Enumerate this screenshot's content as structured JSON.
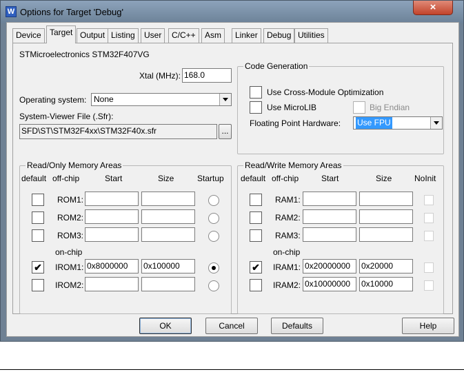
{
  "window": {
    "title": "Options for Target 'Debug'",
    "app_icon_glyph": "W",
    "close_glyph": "×",
    "accent": "#6f8194"
  },
  "tabs": [
    {
      "label": "Device"
    },
    {
      "label": "Target",
      "active": true
    },
    {
      "label": "Output"
    },
    {
      "label": "Listing"
    },
    {
      "label": "User"
    },
    {
      "label": "C/C++"
    },
    {
      "label": "Asm"
    },
    {
      "label": "Linker"
    },
    {
      "label": "Debug"
    },
    {
      "label": "Utilities"
    }
  ],
  "target": {
    "device_name": "STMicroelectronics STM32F407VG",
    "xtal_label": "Xtal (MHz):",
    "xtal_value": "168.0",
    "os_label": "Operating system:",
    "os_value": "None",
    "sfr_label": "System-Viewer File (.Sfr):",
    "sfr_value": "SFD\\ST\\STM32F4xx\\STM32F40x.sfr",
    "browse_label": "..."
  },
  "code_gen": {
    "title": "Code Generation",
    "cross_module": {
      "label": "Use Cross-Module Optimization",
      "checked": false
    },
    "microlib": {
      "label": "Use MicroLIB",
      "checked": false
    },
    "big_endian": {
      "label": "Big Endian",
      "checked": false,
      "disabled": true
    },
    "fpu_label": "Floating Point Hardware:",
    "fpu_value": "Use FPU"
  },
  "ro_memory": {
    "title": "Read/Only Memory Areas",
    "headers": {
      "default": "default",
      "offchip": "off-chip",
      "start": "Start",
      "size": "Size",
      "startup": "Startup"
    },
    "onchip_label": "on-chip",
    "rows": [
      {
        "name": "ROM1:",
        "default": false,
        "start": "",
        "size": "",
        "startup": false
      },
      {
        "name": "ROM2:",
        "default": false,
        "start": "",
        "size": "",
        "startup": false
      },
      {
        "name": "ROM3:",
        "default": false,
        "start": "",
        "size": "",
        "startup": false
      },
      {
        "name": "IROM1:",
        "default": true,
        "start": "0x8000000",
        "size": "0x100000",
        "startup": true
      },
      {
        "name": "IROM2:",
        "default": false,
        "start": "",
        "size": "",
        "startup": false
      }
    ]
  },
  "rw_memory": {
    "title": "Read/Write Memory Areas",
    "headers": {
      "default": "default",
      "offchip": "off-chip",
      "start": "Start",
      "size": "Size",
      "noinit": "NoInit"
    },
    "onchip_label": "on-chip",
    "rows": [
      {
        "name": "RAM1:",
        "default": false,
        "start": "",
        "size": "",
        "noinit": false
      },
      {
        "name": "RAM2:",
        "default": false,
        "start": "",
        "size": "",
        "noinit": false
      },
      {
        "name": "RAM3:",
        "default": false,
        "start": "",
        "size": "",
        "noinit": false
      },
      {
        "name": "IRAM1:",
        "default": true,
        "start": "0x20000000",
        "size": "0x20000",
        "noinit": false
      },
      {
        "name": "IRAM2:",
        "default": false,
        "start": "0x10000000",
        "size": "0x10000",
        "noinit": false
      }
    ]
  },
  "buttons": {
    "ok": "OK",
    "cancel": "Cancel",
    "defaults": "Defaults",
    "help": "Help"
  }
}
